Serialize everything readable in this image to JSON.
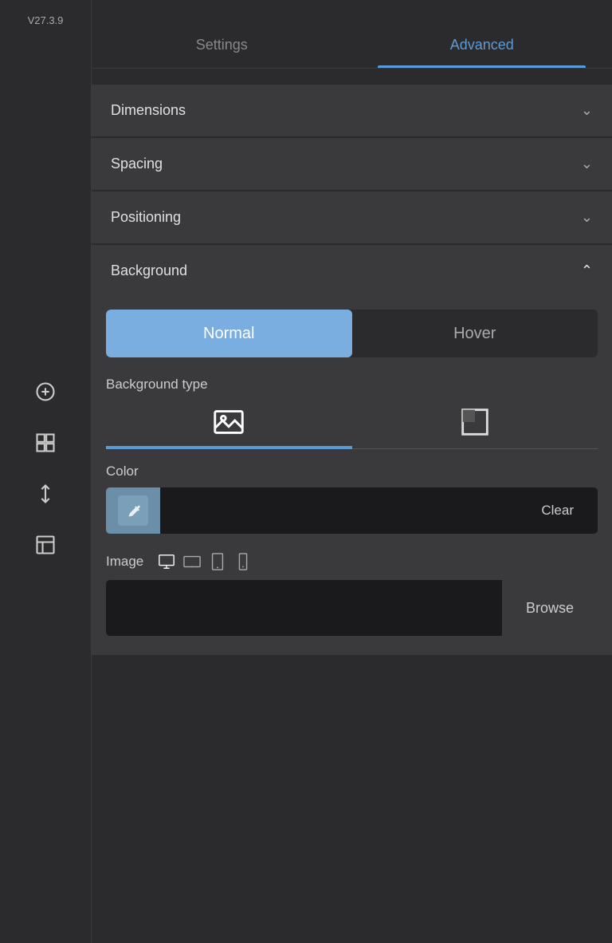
{
  "app": {
    "version": "V27.3.9"
  },
  "tabs": [
    {
      "id": "settings",
      "label": "Settings",
      "active": false
    },
    {
      "id": "advanced",
      "label": "Advanced",
      "active": true
    }
  ],
  "accordion": {
    "dimensions": {
      "label": "Dimensions",
      "expanded": false
    },
    "spacing": {
      "label": "Spacing",
      "expanded": false
    },
    "positioning": {
      "label": "Positioning",
      "expanded": false
    },
    "background": {
      "label": "Background",
      "expanded": true
    }
  },
  "background": {
    "toggle": {
      "normal_label": "Normal",
      "hover_label": "Hover",
      "active": "normal"
    },
    "type_label": "Background type",
    "color_label": "Color",
    "clear_button_label": "Clear",
    "image_label": "Image",
    "browse_label": "Browse",
    "devices": [
      "desktop",
      "tablet",
      "tablet-sm",
      "mobile"
    ]
  },
  "sidebar": {
    "icons": [
      {
        "name": "add-icon",
        "symbol": "add"
      },
      {
        "name": "layout-icon",
        "symbol": "layout"
      },
      {
        "name": "sort-icon",
        "symbol": "sort"
      },
      {
        "name": "frame-icon",
        "symbol": "frame"
      }
    ]
  }
}
